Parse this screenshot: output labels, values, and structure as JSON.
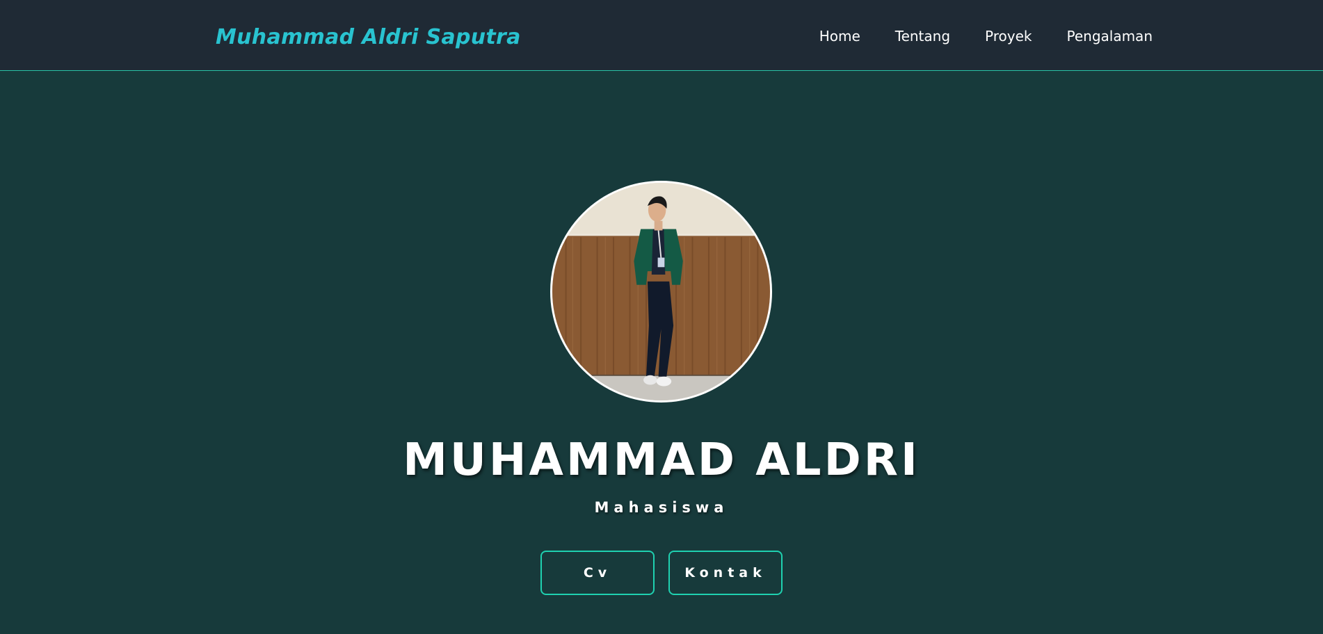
{
  "header": {
    "brand": "Muhammad Aldri Saputra",
    "nav": [
      {
        "label": "Home"
      },
      {
        "label": "Tentang"
      },
      {
        "label": "Proyek"
      },
      {
        "label": "Pengalaman"
      }
    ]
  },
  "hero": {
    "avatar_icon": "profile-photo",
    "title": "MUHAMMAD ALDRI",
    "subtitle": "Mahasiswa",
    "buttons": [
      {
        "label": "Cv"
      },
      {
        "label": "Kontak"
      }
    ]
  },
  "colors": {
    "background": "#173a3b",
    "navbar": "#1f2a35",
    "brand": "#29c3d0",
    "accent": "#1fd1b0",
    "text": "#ffffff"
  }
}
